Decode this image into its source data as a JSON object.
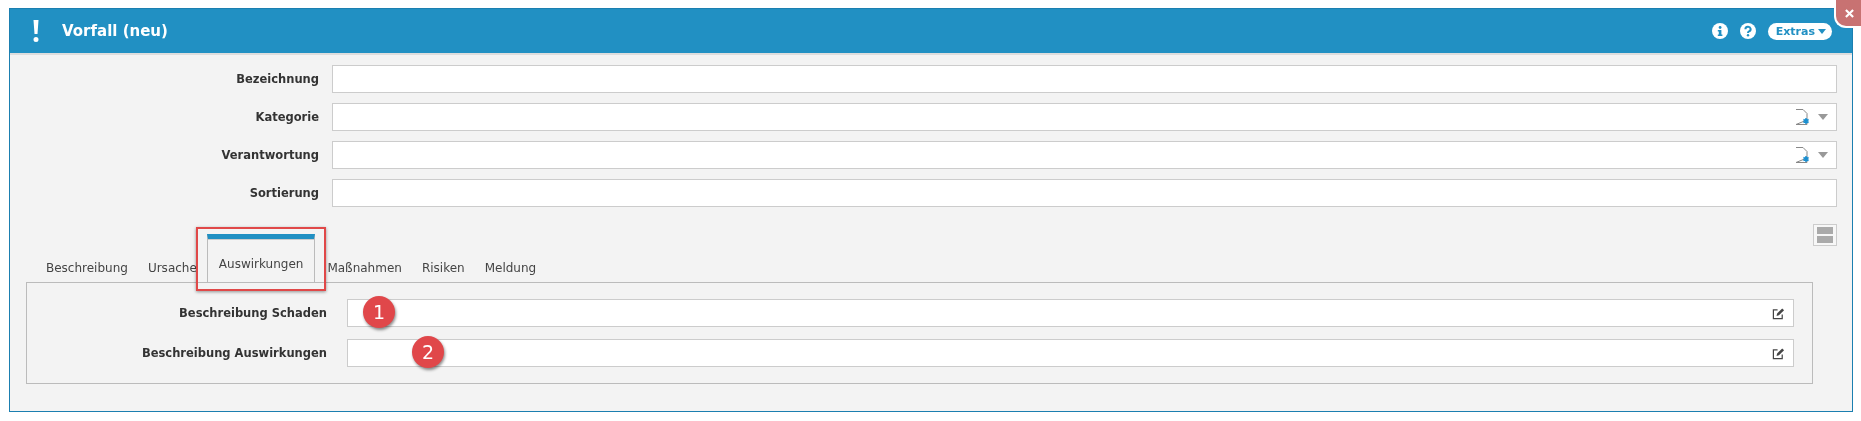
{
  "window": {
    "title": "Vorfall (neu)"
  },
  "header_actions": [
    {
      "kind": "info"
    },
    {
      "kind": "help"
    },
    {
      "kind": "menu",
      "label": "Extras"
    }
  ],
  "fields": [
    {
      "label": "Bezeichnung",
      "kind": "text"
    },
    {
      "label": "Kategorie",
      "kind": "select"
    },
    {
      "label": "Verantwortung",
      "kind": "select"
    },
    {
      "label": "Sortierung",
      "kind": "text"
    }
  ],
  "tabs": [
    {
      "label": "Beschreibung",
      "selected": false,
      "highlighted": false
    },
    {
      "label": "Ursache",
      "selected": false,
      "highlighted": false
    },
    {
      "label": "Auswirkungen",
      "selected": true,
      "highlighted": true
    },
    {
      "label": "Maßnahmen",
      "selected": false,
      "highlighted": false
    },
    {
      "label": "Risiken",
      "selected": false,
      "highlighted": false
    },
    {
      "label": "Meldung",
      "selected": false,
      "highlighted": false
    }
  ],
  "panel_fields": [
    {
      "label": "Beschreibung Schaden",
      "badge": "1"
    },
    {
      "label": "Beschreibung Auswirkungen",
      "badge": "2"
    }
  ]
}
